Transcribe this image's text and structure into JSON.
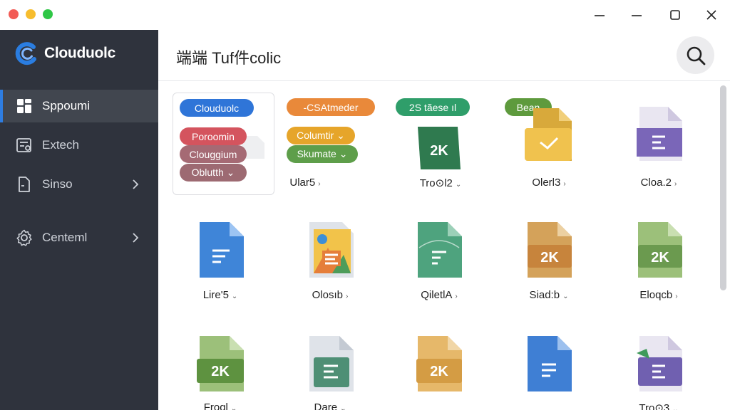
{
  "window": {
    "controls": {
      "minimize_icon": "minimize-icon",
      "maximize_icon": "maximize-icon",
      "close_icon": "close-icon"
    }
  },
  "sidebar": {
    "brand": "Clouduolc",
    "items": [
      {
        "label": "Sppoumi",
        "icon": "grid-icon",
        "active": true
      },
      {
        "label": "Extech",
        "icon": "settings-panel-icon"
      },
      {
        "label": "Sinso",
        "icon": "document-icon",
        "chevron": true
      },
      {
        "label": "Centeml",
        "icon": "gear-icon",
        "chevron": true
      }
    ]
  },
  "header": {
    "title": "端端 Tuf件colic",
    "search_icon": "search-icon"
  },
  "card": {
    "pills": [
      {
        "label": "Clouduolc",
        "color": "#2f75d8"
      },
      {
        "label": "Poroomin",
        "color": "#d4545e"
      },
      {
        "label": "Clouggium",
        "color": "#a56a74"
      },
      {
        "label": "Oblutth ⌄",
        "color": "#9d6a72"
      }
    ]
  },
  "tags": [
    {
      "label": "-CSAtmeder",
      "color": "#e9893a"
    },
    {
      "label": "Columtir ⌄",
      "color": "#e6a52a"
    },
    {
      "label": "Skumate ⌄",
      "color": "#5e9e4a"
    },
    {
      "label": "2S tãese ıl",
      "color": "#2f9e6a"
    },
    {
      "label": "Bean",
      "color": "#5e9a3d"
    }
  ],
  "files": [
    {
      "label": "Ular5",
      "color": "#222222"
    },
    {
      "label": "Tro⊙l2",
      "icon": "2K",
      "color": "#2f7a4f"
    },
    {
      "label": "Olerl3",
      "color": "#d8a93b"
    },
    {
      "label": "Cloa.2",
      "color": "#7a66b8"
    },
    {
      "label": "Lire'5",
      "color": "#3f85d8"
    },
    {
      "label": "Olosıb",
      "color": "#e08a3a"
    },
    {
      "label": "QiletlA",
      "color": "#4ea37e"
    },
    {
      "label": "Siad:b",
      "icon": "2K",
      "color": "#c7843c"
    },
    {
      "label": "Eloqcb",
      "icon": "2K",
      "color": "#6b9a4f"
    },
    {
      "label": "Froql",
      "icon": "2K",
      "color": "#5e9240"
    },
    {
      "label": "Dare",
      "color": "#4e8f75"
    },
    {
      "label": "",
      "icon": "2K",
      "color": "#d49c44"
    },
    {
      "label": "",
      "color": "#3f7fd4"
    },
    {
      "label": "Tro⊙3",
      "color": "#7060b0"
    }
  ]
}
